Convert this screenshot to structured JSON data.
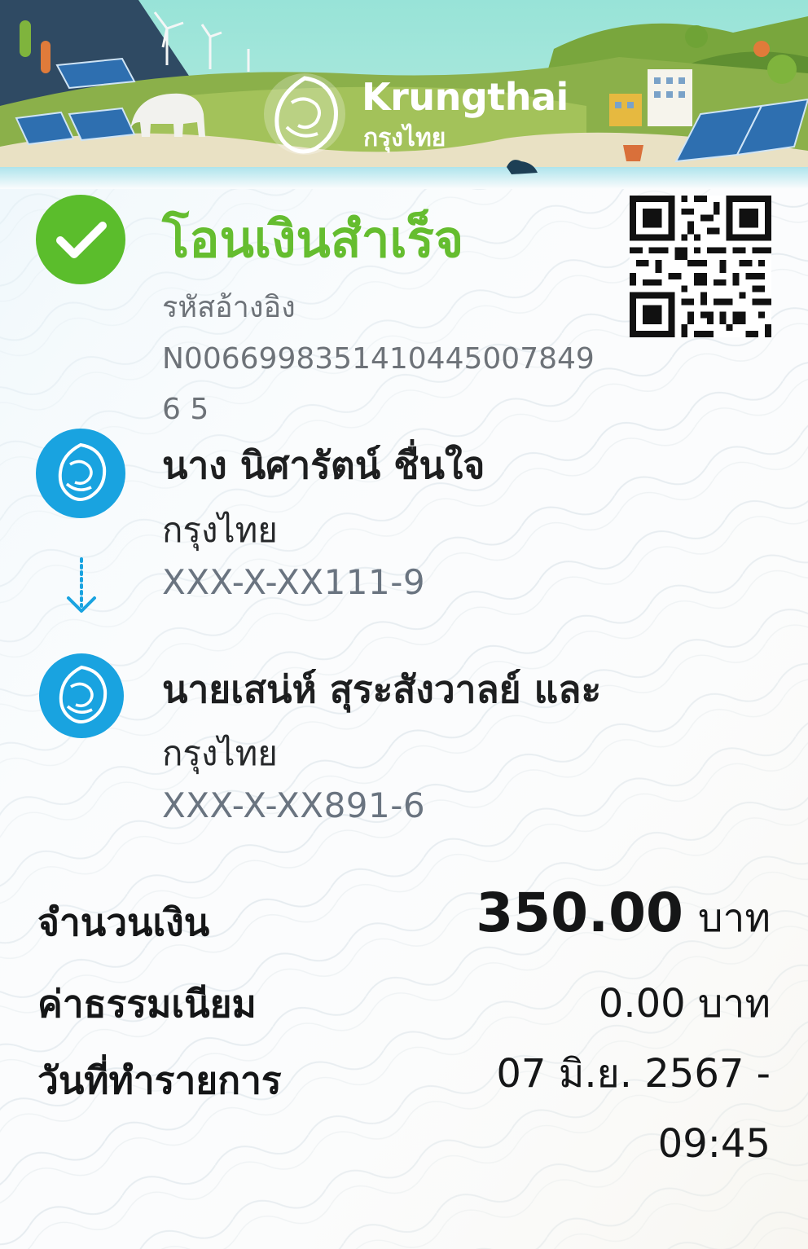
{
  "bank": {
    "name": "Krungthai",
    "name_thai": "กรุงไทย"
  },
  "status": {
    "title": "โอนเงินสำเร็จ",
    "ref_label": "รหัสอ้างอิง",
    "ref_number": "N00669983514104450078496 5",
    "qr_icon": "qr-code-icon"
  },
  "sender": {
    "name": "นาง นิศารัตน์ ชื่นใจ",
    "bank": "กรุงไทย",
    "account": "XXX-X-XX111-9"
  },
  "receiver": {
    "name": "นายเสน่ห์ สุระสังวาลย์ และ",
    "bank": "กรุงไทย",
    "account": "XXX-X-XX891-6"
  },
  "summary": {
    "amount_label": "จำนวนเงิน",
    "amount_value": "350.00",
    "amount_unit": "บาท",
    "fee_label": "ค่าธรรมเนียม",
    "fee_value": "0.00 บาท",
    "date_label": "วันที่ทำรายการ",
    "date_line1": "07 มิ.ย. 2567 -",
    "date_line2": "09:45"
  },
  "colors": {
    "success_green": "#5bbd2c",
    "brand_blue": "#19a3e0",
    "banner_green": "#8bb04a"
  }
}
